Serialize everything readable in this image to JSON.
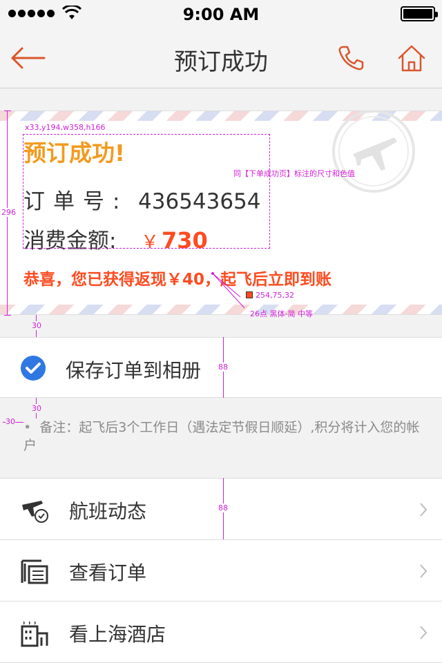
{
  "status_bar": {
    "time": "9:00 AM"
  },
  "nav": {
    "title": "预订成功",
    "back_icon": "back-arrow-icon",
    "phone_icon": "phone-icon",
    "home_icon": "home-icon",
    "accent_color": "#d9562b"
  },
  "success": {
    "title": "预订成功!",
    "order_label": "订单号:",
    "order_number": "436543654",
    "amount_label": "消费金额:",
    "currency": "￥",
    "amount": "730",
    "cashback_text": "恭喜，您已获得返现￥40，起飞后立即到账",
    "title_color": "#f39a1e",
    "highlight_color": "#fe4b20"
  },
  "annotations": {
    "box_label": "x33,y194,w358,h166",
    "note_same": "同【下单成功页】标注的尺寸和色值",
    "color_rgb": "254,75,32",
    "font_spec": "26点 黑体-简 中等",
    "height_card": "296",
    "gap_30_a": "30",
    "gap_30_b": "30",
    "indent_30": "30",
    "height_88_a": "88",
    "height_88_b": "88"
  },
  "save_album": {
    "label": "保存订单到相册",
    "checked": true,
    "icon": "checkmark-circle-icon"
  },
  "note": {
    "text": "备注：起飞后3个工作日（遇法定节假日顺延）,积分将计入您的帐户"
  },
  "menu": [
    {
      "label": "航班动态",
      "icon": "flight-status-icon"
    },
    {
      "label": "查看订单",
      "icon": "order-list-icon"
    },
    {
      "label": "看上海酒店",
      "icon": "hotel-icon"
    }
  ]
}
